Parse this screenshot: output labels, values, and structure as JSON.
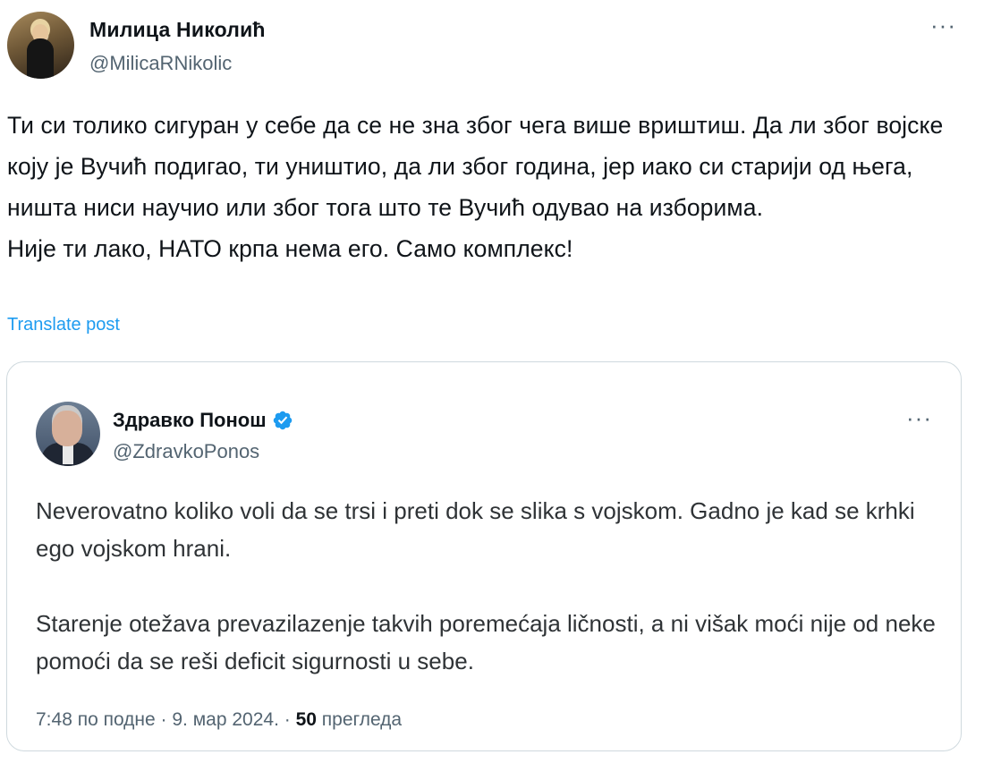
{
  "author": {
    "name": "Милица Николић",
    "handle": "@MilicaRNikolic"
  },
  "more_label": "···",
  "tweet": {
    "paragraphs": [
      "Ти си толико сигуран у себе да се не зна због чега више вриштиш. Да ли због војске коју је Вучић подигао, ти уништио, да ли због година, јер иако си старији од њега, ништа ниси научио или због тога што те Вучић одувао на изборима.",
      "Није ти лако, НАТО крпа нема его. Само комплекс!"
    ],
    "translate_label": "Translate post"
  },
  "quoted": {
    "name": "Здравко Понош",
    "handle": "@ZdravkoPonos",
    "verified": true,
    "paragraphs": [
      "Neverovatno koliko voli da se trsi i preti dok se slika s vojskom. Gadno je kad se krhki ego vojskom hrani.",
      "Starenje otežava prevazilazenje takvih poremećaja ličnosti, a ni višak moći nije od neke pomoći da se reši deficit sigurnosti u sebe."
    ],
    "timestamp": "7:48 по подне · 9. мар 2024. · ",
    "views_count": "50",
    "views_label": " прегледа"
  },
  "colors": {
    "link": "#1d9bf0",
    "secondary_text": "#536471",
    "border": "#cfd9de"
  }
}
